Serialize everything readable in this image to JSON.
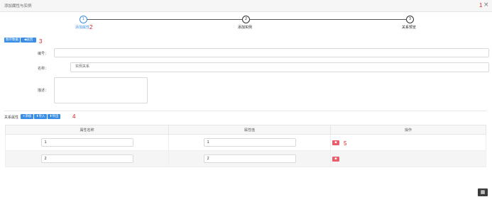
{
  "dialog": {
    "title": "添加属性与实例",
    "close_icon": "×"
  },
  "annotations": {
    "a1": "1",
    "a2": "2",
    "a3": "3",
    "a4": "4",
    "a5": "5"
  },
  "steps": [
    {
      "num": "1",
      "label": "添加属性",
      "active": true
    },
    {
      "num": "2",
      "label": "添加实例",
      "active": false
    },
    {
      "num": "3",
      "label": "关系预览",
      "active": false
    }
  ],
  "toolbar": {
    "save_label": "暂存数据",
    "back_label": "◀返回"
  },
  "form": {
    "code_label": "编号：",
    "code_value": "",
    "name_label": "名称：",
    "name_value": "实例关系",
    "desc_label": "描述：",
    "desc_value": ""
  },
  "relation": {
    "section_label": "关系属性",
    "add_label": "+添加",
    "import_label": "⬆导入",
    "export_label": "⬆导出"
  },
  "table": {
    "headers": [
      "属性名称",
      "属性值",
      "操作"
    ],
    "rows": [
      {
        "name": "1",
        "value": "1",
        "action": "▪"
      },
      {
        "name": "2",
        "value": "2",
        "action": "▪"
      }
    ]
  },
  "float": {
    "calculator_icon": "▦"
  },
  "colors": {
    "accent": "#3a8ee6",
    "danger": "#e85d6b",
    "annotation": "#e02020"
  }
}
